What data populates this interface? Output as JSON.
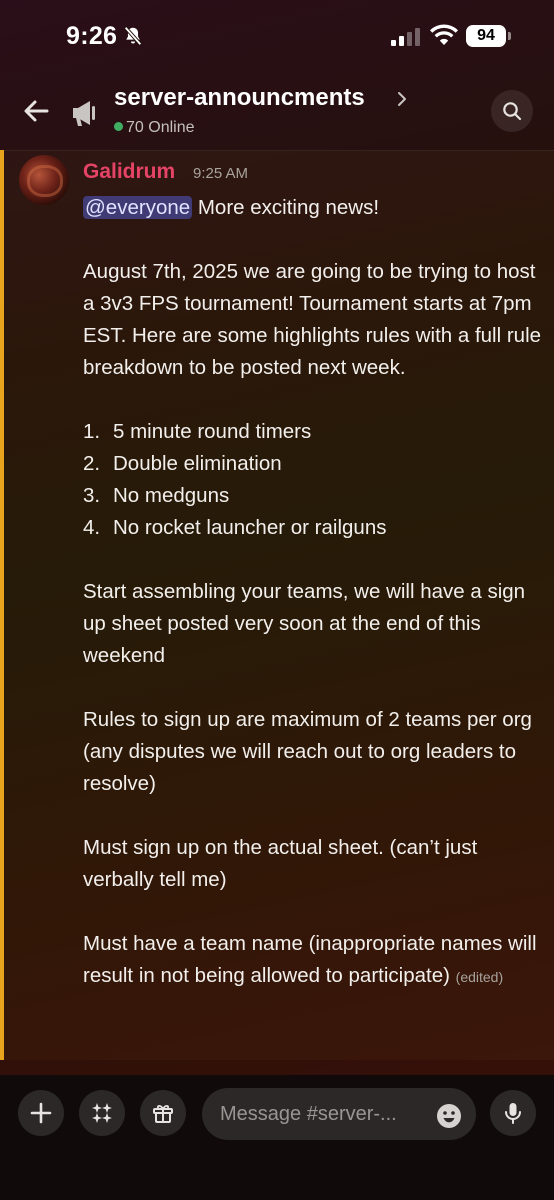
{
  "status_bar": {
    "time": "9:26",
    "battery": "94"
  },
  "header": {
    "channel_name": "server-announcments",
    "online_count": "70 Online"
  },
  "message": {
    "author": "Galidrum",
    "timestamp": "9:25 AM",
    "mention": "@everyone",
    "intro": "More exciting news!",
    "p1": "August 7th, 2025 we are going to be trying to host a 3v3 FPS tournament! Tournament starts at 7pm EST. Here are some highlights rules with a full rule breakdown to be posted next week.",
    "rules": [
      {
        "n": "1.",
        "text": "5 minute round timers"
      },
      {
        "n": "2.",
        "text": "Double elimination"
      },
      {
        "n": "3.",
        "text": "No medguns"
      },
      {
        "n": "4.",
        "text": "No rocket launcher or railguns"
      }
    ],
    "p2": "Start assembling your teams, we will have a sign up sheet posted very soon at the end of this weekend",
    "p3": "Rules to sign up are maximum of 2 teams per org (any disputes we will reach out to org leaders to resolve)",
    "p4": "Must sign up on the actual sheet. (can’t just verbally tell me)",
    "p5": "Must have a team name (inappropriate names will result in not being allowed to participate)",
    "edited": "(edited)"
  },
  "composer": {
    "placeholder": "Message #server-..."
  },
  "colors": {
    "author": "#e54466",
    "mention_bg": "#5865f2",
    "highlight_bar": "#e8a41c",
    "online": "#3fae62"
  }
}
